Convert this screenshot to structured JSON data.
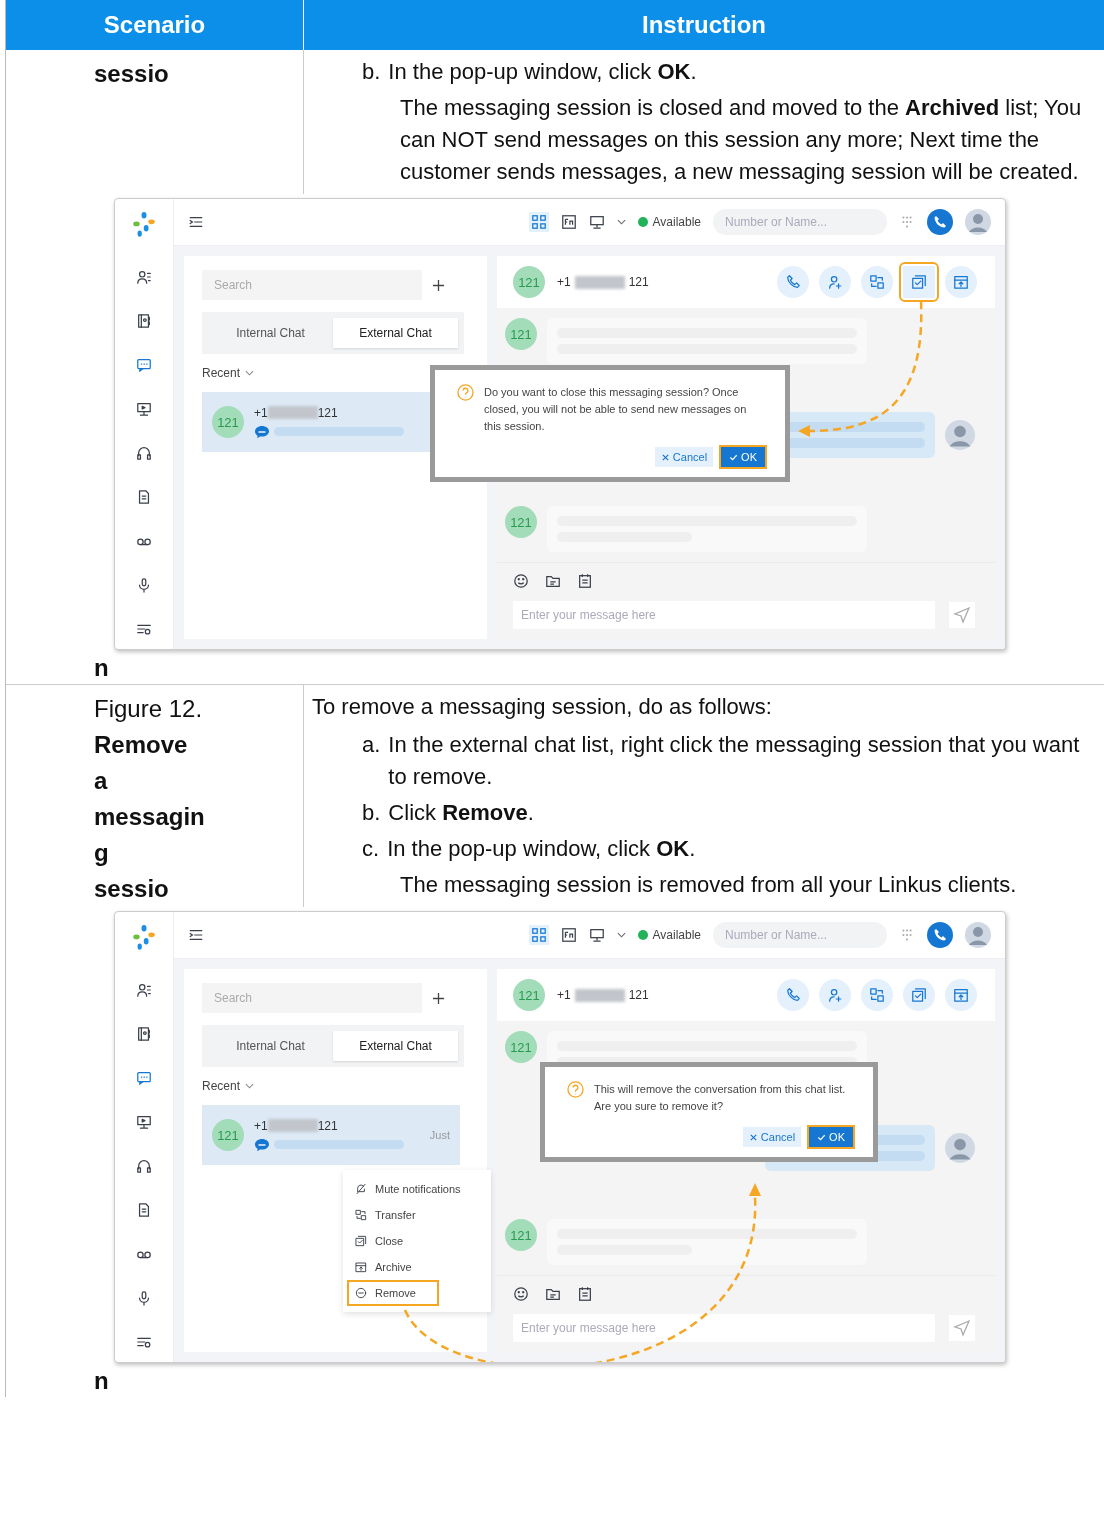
{
  "table": {
    "columns": [
      "Scenario",
      "Instruction"
    ],
    "rows": [
      {
        "scenario_lines": [
          {
            "text": "sessio",
            "bold": true
          }
        ],
        "scenario_tail": {
          "text": "n",
          "bold": true
        },
        "steps": [
          {
            "marker": "b.",
            "text": "In the pop-up window, click **OK**."
          }
        ],
        "result": "The messaging session is closed and moved to the **Archived** list; You can NOT send messages on this session any more; Next time the customer sends messages, a new messaging session will be created.",
        "figure": {
          "rail": [
            {
              "kind": "contacts",
              "selected": false
            },
            {
              "kind": "phonebook",
              "selected": false
            },
            {
              "kind": "chat",
              "selected": true
            },
            {
              "kind": "monitor",
              "selected": false
            },
            {
              "kind": "headset",
              "selected": false
            },
            {
              "kind": "document",
              "selected": false
            },
            {
              "kind": "voicemail",
              "selected": false
            },
            {
              "kind": "microphone",
              "selected": false
            },
            {
              "kind": "settings",
              "selected": false
            }
          ],
          "topbar": {
            "status": "Available",
            "search_placeholder": "Number or Name..."
          },
          "list": {
            "search_placeholder": "Search",
            "tabs": [
              {
                "label": "Internal Chat",
                "selected": false
              },
              {
                "label": "External Chat",
                "selected": true
              }
            ],
            "section": "Recent",
            "conversation": {
              "avatar": "121",
              "number_prefix": "+1",
              "number_suffix": "121",
              "selected": true
            }
          },
          "chat": {
            "avatar": "121",
            "number_prefix": "+1",
            "number_suffix": "121",
            "actions": [
              {
                "kind": "call",
                "highlighted": false
              },
              {
                "kind": "add_contact",
                "highlighted": false
              },
              {
                "kind": "transfer",
                "highlighted": false
              },
              {
                "kind": "close",
                "highlighted": true
              },
              {
                "kind": "archive",
                "highlighted": false
              }
            ],
            "message_avatars": [
              "121",
              "121"
            ],
            "composer_placeholder": "Enter your message here"
          },
          "dialog": {
            "text": "Do you want to close this messaging session? Once closed, you will not be able to send new messages on this session.",
            "cancel": "Cancel",
            "ok": "OK",
            "ok_highlighted": true
          }
        }
      },
      {
        "scenario_lines": [
          {
            "text": "Figure 12.",
            "bold": false
          },
          {
            "text": "Remove",
            "bold": true
          },
          {
            "text": "a",
            "bold": true
          },
          {
            "text": "messagin",
            "bold": true
          },
          {
            "text": "g",
            "bold": true
          },
          {
            "text": "sessio",
            "bold": true
          }
        ],
        "scenario_tail": {
          "text": "n",
          "bold": true
        },
        "intro": "To remove a messaging session, do as follows:",
        "steps": [
          {
            "marker": "a.",
            "text": "In the external chat list, right click the messaging session that you want to remove."
          },
          {
            "marker": "b.",
            "text": "Click **Remove**."
          },
          {
            "marker": "c.",
            "text": "In the pop-up window, click **OK**."
          }
        ],
        "result": "The messaging session is removed from all your Linkus clients.",
        "figure": {
          "rail": [
            {
              "kind": "contacts",
              "selected": false
            },
            {
              "kind": "phonebook",
              "selected": false
            },
            {
              "kind": "chat",
              "selected": true
            },
            {
              "kind": "monitor",
              "selected": false
            },
            {
              "kind": "headset",
              "selected": false
            },
            {
              "kind": "document",
              "selected": false
            },
            {
              "kind": "voicemail",
              "selected": false
            },
            {
              "kind": "microphone",
              "selected": false
            },
            {
              "kind": "settings",
              "selected": false
            }
          ],
          "topbar": {
            "status": "Available",
            "search_placeholder": "Number or Name..."
          },
          "list": {
            "search_placeholder": "Search",
            "tabs": [
              {
                "label": "Internal Chat",
                "selected": false
              },
              {
                "label": "External Chat",
                "selected": true
              }
            ],
            "section": "Recent",
            "conversation": {
              "avatar": "121",
              "number_prefix": "+1",
              "number_suffix": "121",
              "time": "Just",
              "selected": true
            }
          },
          "chat": {
            "avatar": "121",
            "number_prefix": "+1",
            "number_suffix": "121",
            "actions": [
              {
                "kind": "call",
                "highlighted": false
              },
              {
                "kind": "add_contact",
                "highlighted": false
              },
              {
                "kind": "transfer",
                "highlighted": false
              },
              {
                "kind": "close",
                "highlighted": false
              },
              {
                "kind": "archive",
                "highlighted": false
              }
            ],
            "message_avatars": [
              "121",
              "121"
            ],
            "composer_placeholder": "Enter your message here"
          },
          "context_menu": [
            {
              "kind": "mute",
              "label": "Mute notifications",
              "highlighted": false
            },
            {
              "kind": "transfer",
              "label": "Transfer",
              "highlighted": false
            },
            {
              "kind": "close",
              "label": "Close",
              "highlighted": false
            },
            {
              "kind": "archive",
              "label": "Archive",
              "highlighted": false
            },
            {
              "kind": "remove",
              "label": "Remove",
              "highlighted": true
            }
          ],
          "dialog": {
            "text": "This will remove the conversation from this chat list. Are you sure to remove it?",
            "cancel": "Cancel",
            "ok": "OK",
            "ok_highlighted": true
          }
        }
      }
    ]
  }
}
